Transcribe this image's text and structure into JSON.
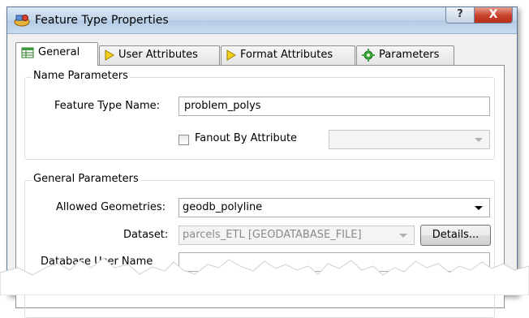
{
  "window": {
    "title": "Feature Type Properties",
    "help_label": "?",
    "close_label": "X"
  },
  "tabs": [
    {
      "label": "General",
      "icon": "table-icon",
      "active": true
    },
    {
      "label": "User Attributes",
      "icon": "yellow-arrow-icon",
      "active": false
    },
    {
      "label": "Format Attributes",
      "icon": "yellow-arrow-icon",
      "active": false
    },
    {
      "label": "Parameters",
      "icon": "green-gear-icon",
      "active": false
    }
  ],
  "name_parameters": {
    "title": "Name Parameters",
    "feature_type_name_label": "Feature Type Name:",
    "feature_type_name_value": "problem_polys",
    "fanout_label": "Fanout By Attribute",
    "fanout_checked": false,
    "fanout_combo_value": ""
  },
  "general_parameters": {
    "title": "General Parameters",
    "allowed_geometries_label": "Allowed Geometries:",
    "allowed_geometries_value": "geodb_polyline",
    "dataset_label": "Dataset:",
    "dataset_value": "parcels_ETL [GEODATABASE_FILE]",
    "details_button": "Details...",
    "partial_label": "Database User Name"
  },
  "colors": {
    "titlebar": "#c2d5ea",
    "close_button": "#c7412b",
    "window_bg": "#f0f0f0",
    "panel_bg": "#ffffff"
  }
}
